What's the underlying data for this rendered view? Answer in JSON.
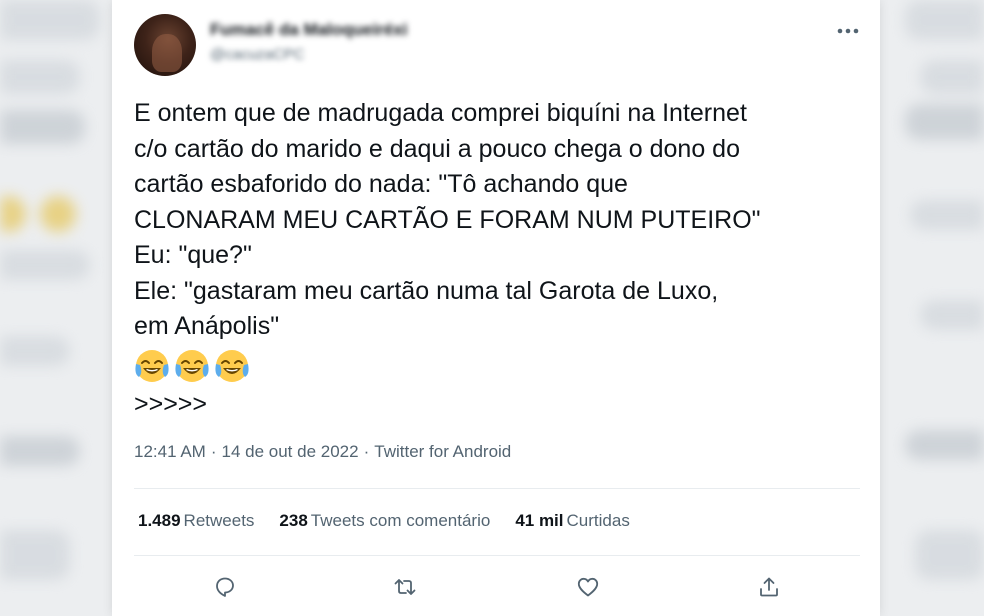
{
  "tweet": {
    "author": {
      "display_name": "Fumacê da Maloqueiréxi",
      "handle": "@cacuzaCPC"
    },
    "text_lines": [
      "E ontem que de madrugada comprei biquíni na Internet",
      "c/o cartão do marido e daqui a pouco chega o dono do",
      "cartão esbaforido do nada: \"Tô achando que",
      "CLONARAM MEU CARTÃO E FORAM NUM PUTEIRO\"",
      "Eu: \"que?\"",
      "Ele: \"gastaram meu cartão numa tal Garota de Luxo,",
      "em Anápolis\""
    ],
    "emojis": [
      "😂",
      "😂",
      "😂"
    ],
    "trailing_text": ">>>>>",
    "time": "12:41 AM",
    "date": "14 de out de 2022",
    "source": "Twitter for Android",
    "separator": "·",
    "stats": {
      "retweets": {
        "count": "1.489",
        "label": "Retweets"
      },
      "quotes": {
        "count": "238",
        "label": "Tweets com comentário"
      },
      "likes": {
        "count": "41 mil",
        "label": "Curtidas"
      }
    }
  },
  "icons": {
    "more": "more-horizontal-icon",
    "reply": "reply-icon",
    "retweet": "retweet-icon",
    "like": "heart-icon",
    "share": "share-icon",
    "emoji": "face-with-tears-of-joy-icon"
  },
  "colors": {
    "text_primary": "#0f1419",
    "text_secondary": "#536471",
    "divider": "#e8ecef",
    "background": "#ffffff"
  }
}
